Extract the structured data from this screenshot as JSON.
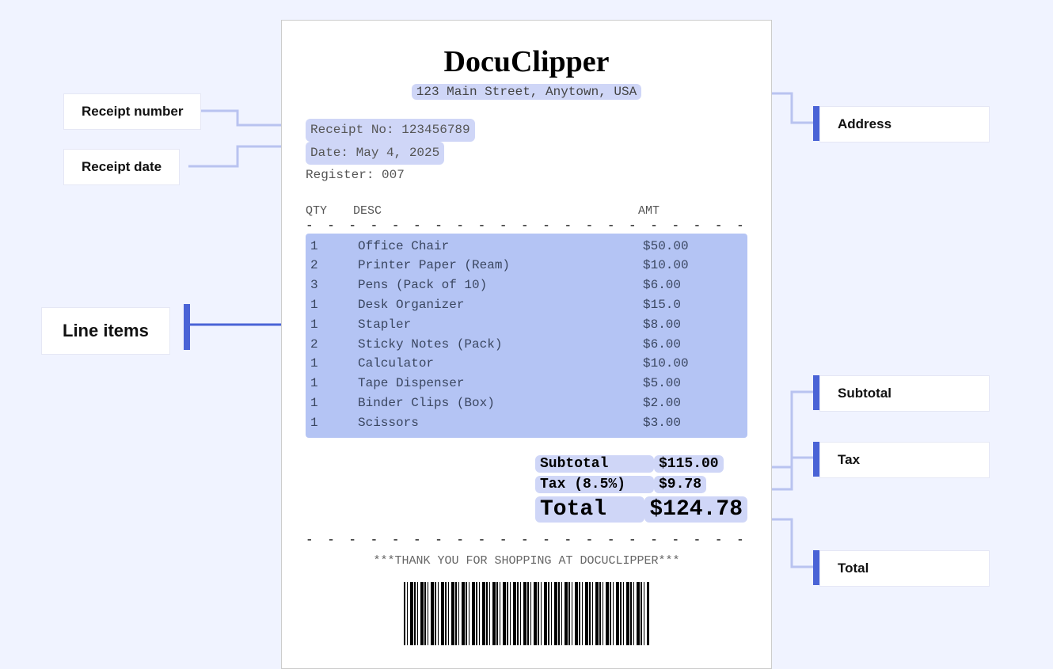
{
  "receipt": {
    "brand": "DocuClipper",
    "address": "123 Main Street, Anytown, USA",
    "receipt_no_label": "Receipt No: ",
    "receipt_no": "123456789",
    "date_label": "Date: ",
    "date": "May 4, 2025",
    "register_label": "Register: ",
    "register": "007",
    "header_qty": "QTY",
    "header_desc": "DESC",
    "header_amt": "AMT",
    "items": [
      {
        "qty": "1",
        "desc": "Office Chair",
        "amt": "$50.00"
      },
      {
        "qty": "2",
        "desc": "Printer Paper (Ream)",
        "amt": "$10.00"
      },
      {
        "qty": "3",
        "desc": "Pens (Pack of 10)",
        "amt": "$6.00"
      },
      {
        "qty": "1",
        "desc": "Desk Organizer",
        "amt": "$15.0"
      },
      {
        "qty": "1",
        "desc": "Stapler",
        "amt": "$8.00"
      },
      {
        "qty": "2",
        "desc": "Sticky Notes (Pack)",
        "amt": "$6.00"
      },
      {
        "qty": "1",
        "desc": "Calculator",
        "amt": "$10.00"
      },
      {
        "qty": "1",
        "desc": "Tape Dispenser",
        "amt": "$5.00"
      },
      {
        "qty": "1",
        "desc": "Binder Clips (Box)",
        "amt": "$2.00"
      },
      {
        "qty": "1",
        "desc": "Scissors",
        "amt": "$3.00"
      }
    ],
    "subtotal_label": "Subtotal",
    "subtotal": "$115.00",
    "tax_label": "Tax (8.5%)",
    "tax": "$9.78",
    "total_label": "Total",
    "total": "$124.78",
    "thankyou": "***THANK YOU FOR SHOPPING AT DOCUCLIPPER***"
  },
  "annotations": {
    "receipt_number": "Receipt number",
    "receipt_date": "Receipt date",
    "line_items": "Line items",
    "address": "Address",
    "subtotal": "Subtotal",
    "tax": "Tax",
    "total": "Total"
  }
}
